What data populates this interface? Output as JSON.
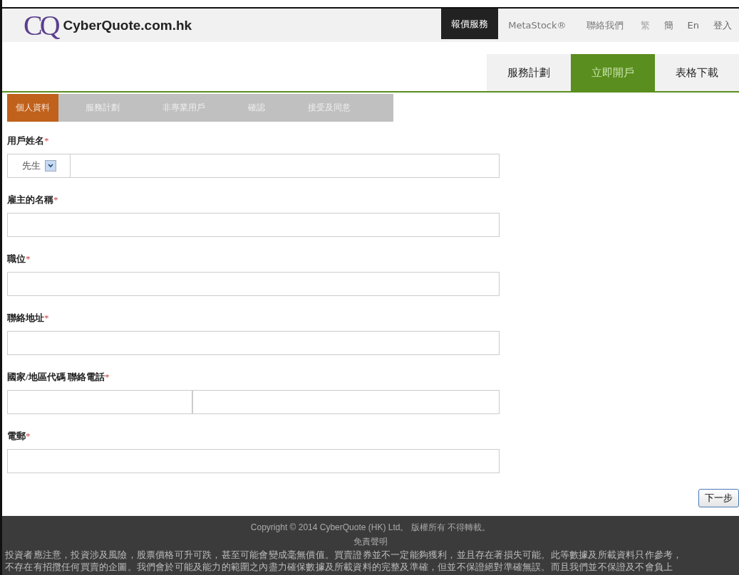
{
  "header": {
    "logo_mark": "CQ",
    "site_name": "CyberQuote.com.hk",
    "nav": [
      {
        "label": "報價服務",
        "selected": true
      },
      {
        "label": "MetaStock®",
        "selected": false
      },
      {
        "label": "聯絡我們",
        "selected": false
      }
    ],
    "languages": [
      {
        "label": "繁",
        "selected": true
      },
      {
        "label": "簡",
        "selected": false
      },
      {
        "label": "En",
        "selected": false
      }
    ],
    "login": "登入"
  },
  "subnav": [
    {
      "label": "服務計劃",
      "selected": false
    },
    {
      "label": "立即開戶",
      "selected": true
    },
    {
      "label": "表格下載",
      "selected": false
    }
  ],
  "steps": [
    {
      "label": "個人資料",
      "selected": true
    },
    {
      "label": "服務計劃",
      "selected": false
    },
    {
      "label": "非專業用戶",
      "selected": false
    },
    {
      "label": "確認",
      "selected": false
    },
    {
      "label": "接受及同意",
      "selected": false
    }
  ],
  "form": [
    {
      "kind": "title",
      "label": "用戶姓名",
      "required": "*",
      "salutation": "先生"
    },
    {
      "kind": "text",
      "label": "雇主的名稱",
      "required": "*"
    },
    {
      "kind": "text",
      "label": "職位",
      "required": "*"
    },
    {
      "kind": "text",
      "label": "聯絡地址",
      "required": "*"
    },
    {
      "kind": "phone",
      "label": "國家/地區代碼 聯絡電話",
      "required": "*"
    },
    {
      "kind": "text",
      "label": "電郵",
      "required": "*"
    }
  ],
  "next_button": "下一步",
  "footer": {
    "copyright": "Copyright © 2014 CyberQuote (HK) Ltd。 版權所有 不得轉載。",
    "disclaimer_title": "免責聲明",
    "disclaimer_lines": [
      "投資者應注意，投資涉及風險，股票價格可升可跌，甚至可能會變成毫無價值。買賣證券並不一定能夠獲利，並且存在著損失可能。此等數據及所載資料只作參考，",
      "不存在有招攬任何買賣的企圖。我們會於可能及能力的範圍之內盡力確保數據及所載資料的完整及準確，但並不保證絕對準確無誤。而且我們並不保證及不會負上"
    ]
  }
}
